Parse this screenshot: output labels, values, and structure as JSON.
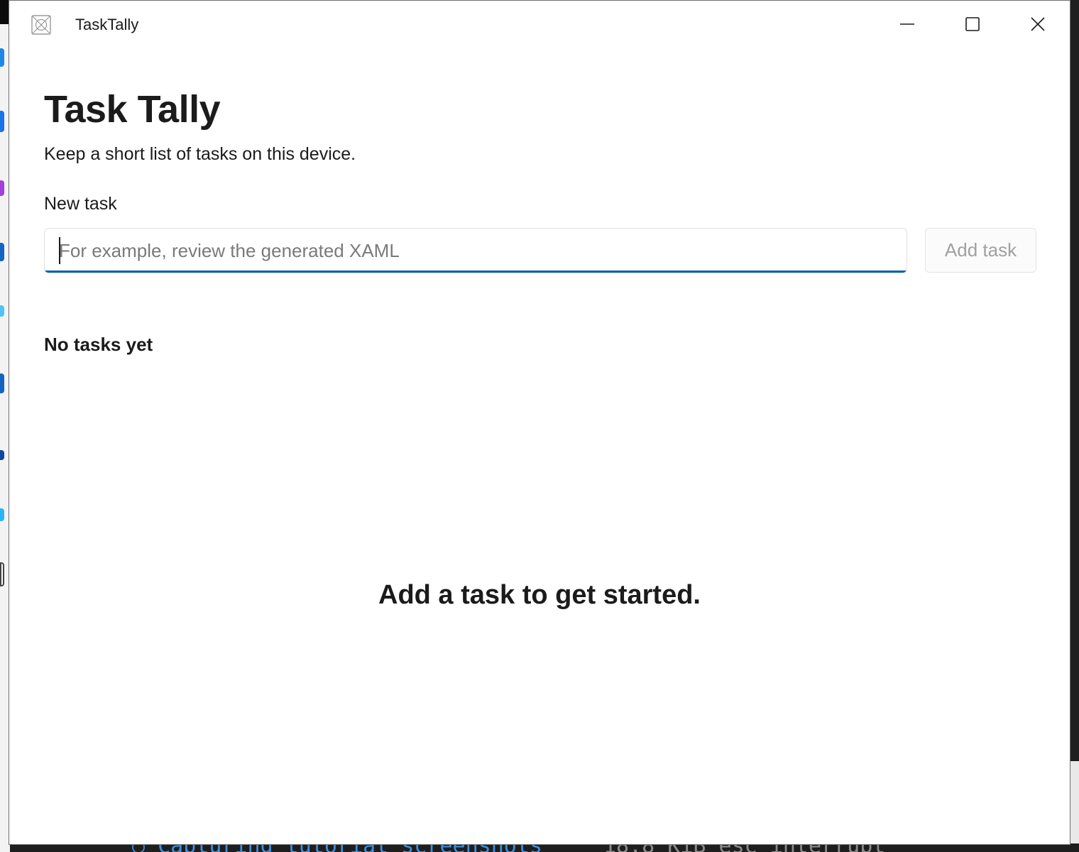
{
  "window": {
    "title": "TaskTally",
    "minimize_icon": "minimize-icon",
    "maximize_icon": "maximize-icon",
    "close_icon": "close-icon"
  },
  "page": {
    "title": "Task Tally",
    "subtitle": "Keep a short list of tasks on this device."
  },
  "new_task": {
    "label": "New task",
    "value": "",
    "placeholder": "For example, review the generated XAML",
    "add_button_label": "Add task",
    "add_button_enabled": false
  },
  "tasks": {
    "heading": "No tasks yet",
    "items": [],
    "empty_message": "Add a task to get started."
  },
  "colors": {
    "accent": "#005fb8",
    "window_background": "#ffffff",
    "text_primary": "#1b1b1b",
    "placeholder_text": "#7a7a7a",
    "disabled_text": "#a0a0a0"
  }
}
